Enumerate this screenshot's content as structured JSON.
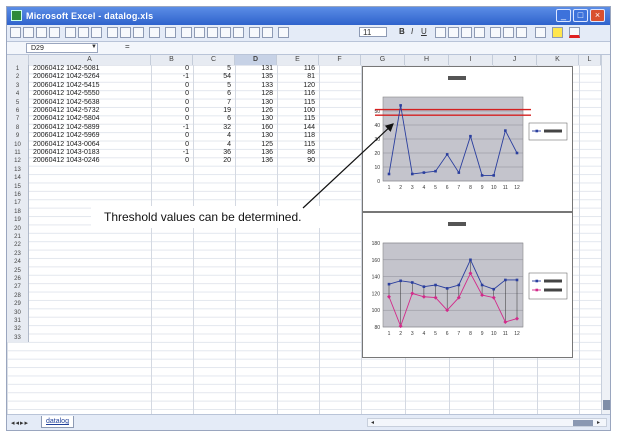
{
  "window": {
    "title": "Microsoft Excel - datalog.xls"
  },
  "formula_bar": {
    "name_box": "D29",
    "fx_label": "="
  },
  "toolbar": {
    "font_size": "11"
  },
  "columns": [
    "A",
    "B",
    "C",
    "D",
    "E",
    "F",
    "G",
    "H",
    "I",
    "J",
    "K",
    "L"
  ],
  "selected_column": "D",
  "rows": [
    {
      "n": "1",
      "a": "20060412 1042-5081",
      "b": "0",
      "c": "5",
      "d": "131",
      "e": "116"
    },
    {
      "n": "2",
      "a": "20060412 1042-5264",
      "b": "-1",
      "c": "54",
      "d": "135",
      "e": "81"
    },
    {
      "n": "3",
      "a": "20060412 1042-5415",
      "b": "0",
      "c": "5",
      "d": "133",
      "e": "120"
    },
    {
      "n": "4",
      "a": "20060412 1042-5550",
      "b": "0",
      "c": "6",
      "d": "128",
      "e": "116"
    },
    {
      "n": "5",
      "a": "20060412 1042-5638",
      "b": "0",
      "c": "7",
      "d": "130",
      "e": "115"
    },
    {
      "n": "6",
      "a": "20060412 1042-5732",
      "b": "0",
      "c": "19",
      "d": "126",
      "e": "100"
    },
    {
      "n": "7",
      "a": "20060412 1042-5804",
      "b": "0",
      "c": "6",
      "d": "130",
      "e": "115"
    },
    {
      "n": "8",
      "a": "20060412 1042-5899",
      "b": "-1",
      "c": "32",
      "d": "160",
      "e": "144"
    },
    {
      "n": "9",
      "a": "20060412 1042-5969",
      "b": "0",
      "c": "4",
      "d": "130",
      "e": "118"
    },
    {
      "n": "10",
      "a": "20060412 1043-0064",
      "b": "0",
      "c": "4",
      "d": "125",
      "e": "115"
    },
    {
      "n": "11",
      "a": "20060412 1043-0183",
      "b": "-1",
      "c": "36",
      "d": "136",
      "e": "86"
    },
    {
      "n": "12",
      "a": "20060412 1043-0246",
      "b": "0",
      "c": "20",
      "d": "136",
      "e": "90"
    }
  ],
  "empty_rows": [
    "13",
    "14",
    "15",
    "16",
    "17",
    "18",
    "19",
    "20",
    "21",
    "22",
    "23",
    "24",
    "25",
    "26",
    "27",
    "28",
    "29",
    "30",
    "31",
    "32",
    "33"
  ],
  "annotation": "Threshold values can be determined.",
  "sheet_tab": "datalog",
  "chart_data": [
    {
      "type": "line",
      "title": "",
      "x": [
        1,
        2,
        3,
        4,
        5,
        6,
        7,
        8,
        9,
        10,
        11,
        12
      ],
      "series": [
        {
          "name": "",
          "color": "#2b3f9e",
          "values": [
            5,
            54,
            5,
            6,
            7,
            19,
            6,
            32,
            4,
            4,
            36,
            20
          ]
        }
      ],
      "ylim": [
        0,
        60
      ],
      "yticks": [
        0,
        10,
        20,
        30,
        40,
        50
      ],
      "threshold_lines": [
        {
          "value": 47,
          "color": "#d42020"
        },
        {
          "value": 51,
          "color": "#d42020"
        }
      ],
      "legend": "right",
      "grid": true,
      "plot_background": "#c4c4cc"
    },
    {
      "type": "line",
      "title": "",
      "x": [
        1,
        2,
        3,
        4,
        5,
        6,
        7,
        8,
        9,
        10,
        11,
        12
      ],
      "series": [
        {
          "name": "",
          "color": "#2b3f9e",
          "values": [
            131,
            135,
            133,
            128,
            130,
            126,
            130,
            160,
            130,
            125,
            136,
            136
          ]
        },
        {
          "name": "",
          "color": "#d22a8a",
          "values": [
            116,
            81,
            120,
            116,
            115,
            100,
            115,
            144,
            118,
            115,
            86,
            90
          ]
        }
      ],
      "ylim": [
        80,
        180
      ],
      "yticks": [
        80,
        100,
        120,
        140,
        160,
        180
      ],
      "legend": "right",
      "grid": true,
      "plot_background": "#c4c4cc"
    }
  ]
}
